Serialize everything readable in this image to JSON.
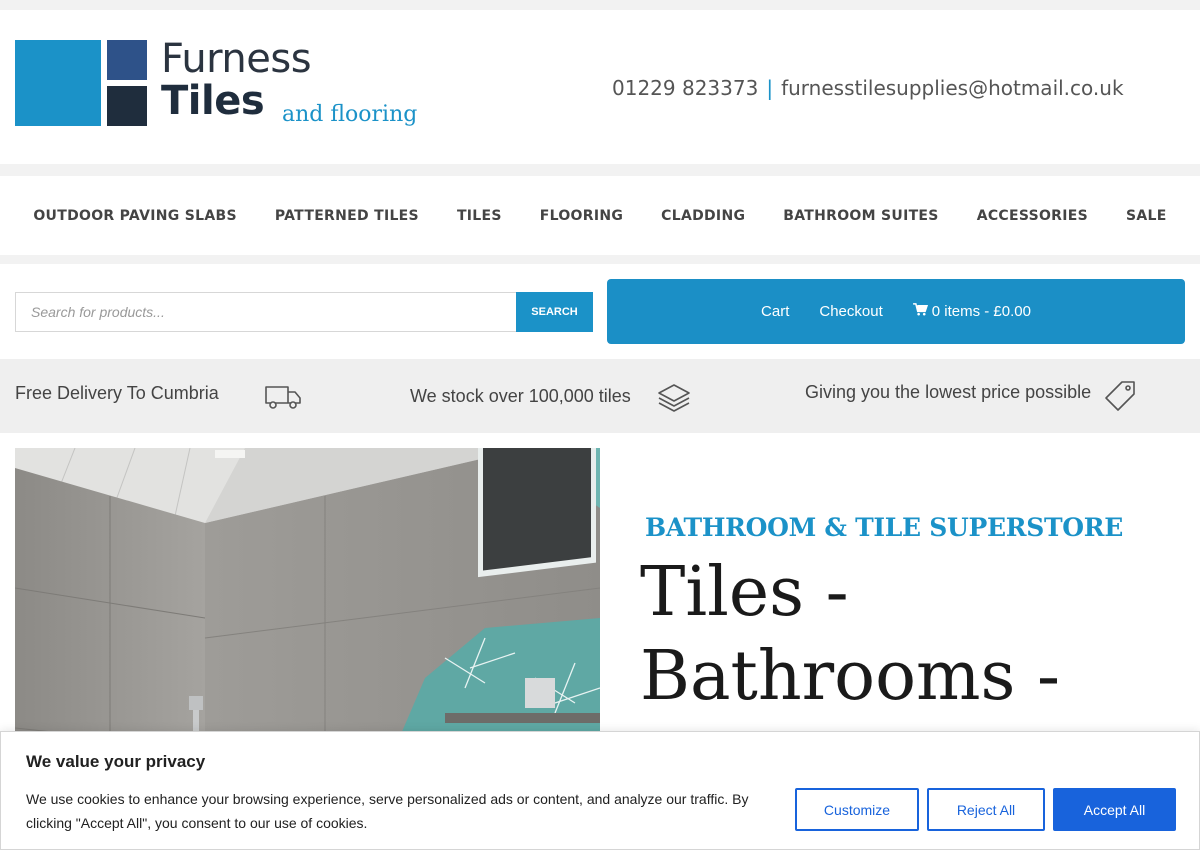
{
  "brand": {
    "line1": "Furness",
    "line2": "Tiles",
    "line3": "and flooring",
    "colors": {
      "blue": "#1b92c8",
      "navy": "#2e5289",
      "dark": "#1f2d3d"
    }
  },
  "contact": {
    "phone": "01229 823373",
    "separator": "|",
    "email": "furnesstilesupplies@hotmail.co.uk"
  },
  "nav": {
    "items": [
      "OUTDOOR PAVING SLABS",
      "PATTERNED TILES",
      "TILES",
      "FLOORING",
      "CLADDING",
      "BATHROOM SUITES",
      "ACCESSORIES",
      "SALE"
    ]
  },
  "search": {
    "placeholder": "Search for products...",
    "button": "SEARCH"
  },
  "cart": {
    "cart_label": "Cart",
    "checkout_label": "Checkout",
    "summary": "0 items - £0.00",
    "icon": "shopping-cart-icon"
  },
  "usp": {
    "delivery": "Free Delivery To Cumbria",
    "delivery_icon": "truck-icon",
    "stock": "We stock over 100,000 tiles",
    "stock_icon": "layers-icon",
    "price": "Giving you the lowest price possible",
    "price_icon": "price-tag-icon"
  },
  "hero": {
    "subtitle": "BATHROOM & TILE SUPERSTORE",
    "title": "Tiles - Bathrooms - Showrooms"
  },
  "cookie": {
    "title": "We value your privacy",
    "text": "We use cookies to enhance your browsing experience, serve personalized ads or content, and analyze our traffic. By clicking \"Accept All\", you consent to our use of cookies.",
    "customize": "Customize",
    "reject": "Reject All",
    "accept": "Accept All",
    "accent": "#1863dc"
  }
}
